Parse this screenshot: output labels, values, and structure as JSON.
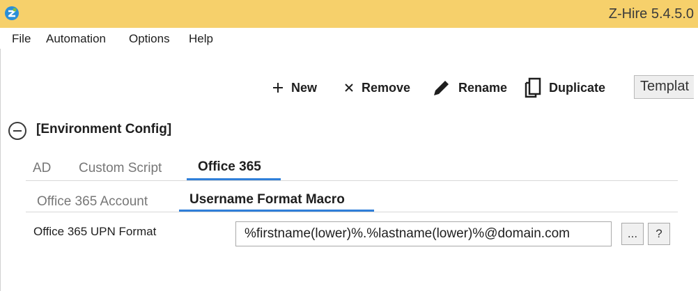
{
  "window": {
    "title": "Z-Hire 5.4.5.0"
  },
  "menu": {
    "items": [
      "File",
      "Automation",
      "Options",
      "Help"
    ]
  },
  "toolbar": {
    "new_label": "New",
    "remove_label": "Remove",
    "rename_label": "Rename",
    "duplicate_label": "Duplicate",
    "templates_label": "Templat"
  },
  "section": {
    "title": "[Environment Config]"
  },
  "tabs": {
    "primary": [
      {
        "label": "AD"
      },
      {
        "label": "Custom Script"
      },
      {
        "label": "Office 365",
        "active": true
      }
    ],
    "secondary": [
      {
        "label": "Office 365 Account"
      },
      {
        "label": "Username Format Macro",
        "active": true
      }
    ]
  },
  "form": {
    "upn_label": "Office 365 UPN Format",
    "upn_value": "%firstname(lower)%.%lastname(lower)%@domain.com",
    "browse_label": "...",
    "help_label": "?"
  },
  "colors": {
    "titlebar": "#f6d06b",
    "accent": "#2f7fd9"
  }
}
